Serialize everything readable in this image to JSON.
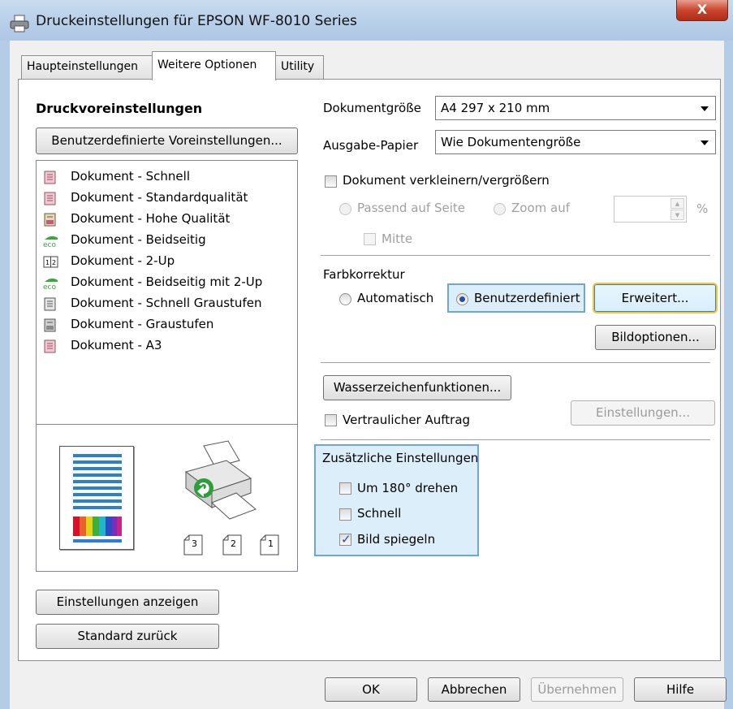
{
  "window": {
    "title": "Druckeinstellungen für EPSON WF-8010 Series",
    "close_label": "X"
  },
  "tabs": [
    {
      "label": "Haupteinstellungen",
      "active": false
    },
    {
      "label": "Weitere Optionen",
      "active": true
    },
    {
      "label": "Utility",
      "active": false
    }
  ],
  "presets": {
    "heading": "Druckvoreinstellungen",
    "custom_button": "Benutzerdefinierte Voreinstellungen...",
    "items": [
      {
        "label": "Dokument - Schnell",
        "icon": "document-pink-icon"
      },
      {
        "label": "Dokument - Standardqualität",
        "icon": "document-pink-icon"
      },
      {
        "label": "Dokument - Hohe Qualität",
        "icon": "document-color-icon"
      },
      {
        "label": "Dokument - Beidseitig",
        "icon": "eco-icon"
      },
      {
        "label": "Dokument - 2-Up",
        "icon": "two-up-icon"
      },
      {
        "label": "Dokument - Beidseitig mit 2-Up",
        "icon": "eco-icon"
      },
      {
        "label": "Dokument - Schnell Graustufen",
        "icon": "document-gray-icon"
      },
      {
        "label": "Dokument - Graustufen",
        "icon": "document-gray-icon"
      },
      {
        "label": "Dokument - A3",
        "icon": "document-pink-icon"
      }
    ],
    "preview_stack_labels": [
      "3",
      "2",
      "1"
    ]
  },
  "left_buttons": {
    "show_settings": "Einstellungen anzeigen",
    "reset_defaults": "Standard zurück"
  },
  "document_size": {
    "label": "Dokumentgröße",
    "value": "A4 297 x 210 mm"
  },
  "output_paper": {
    "label": "Ausgabe-Papier",
    "value": "Wie Dokumentengröße"
  },
  "scale": {
    "checkbox_label": "Dokument verkleinern/vergrößern",
    "fit_page": "Passend auf Seite",
    "zoom": "Zoom auf",
    "zoom_value": "",
    "percent": "%",
    "center": "Mitte"
  },
  "color_correction": {
    "heading": "Farbkorrektur",
    "automatic": "Automatisch",
    "custom": "Benutzerdefiniert",
    "advanced_button": "Erweitert...",
    "image_options_button": "Bildoptionen..."
  },
  "watermark": {
    "button": "Wasserzeichenfunktionen...",
    "confidential": "Vertraulicher Auftrag",
    "settings_button": "Einstellungen..."
  },
  "additional": {
    "heading": "Zusätzliche Einstellungen",
    "rotate": {
      "label": "Um 180° drehen",
      "checked": false
    },
    "fast": {
      "label": "Schnell",
      "checked": false
    },
    "mirror": {
      "label": "Bild spiegeln",
      "checked": true
    }
  },
  "footer": {
    "ok": "OK",
    "cancel": "Abbrechen",
    "apply": "Übernehmen",
    "help": "Hilfe"
  }
}
